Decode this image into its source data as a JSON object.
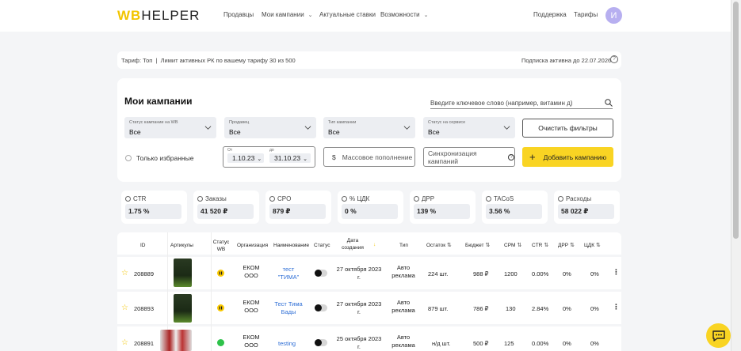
{
  "header": {
    "logo_wb": "WB",
    "logo_helper": "HELPER",
    "nav": [
      {
        "label": "Продавцы",
        "chevron": false
      },
      {
        "label": "Мои кампании",
        "chevron": true
      },
      {
        "label": "Актуальные ставки",
        "chevron": false
      },
      {
        "label": "Возможности",
        "chevron": true
      }
    ],
    "support": "Поддержка",
    "tariffs": "Тарифы",
    "avatar_letter": "И"
  },
  "tariff_bar": {
    "left": "Тариф: Топ  |  Лимит активных РК по вашему тарифу 30 из 500",
    "right": "Подписка активна до 22.07.2026"
  },
  "filters": {
    "title": "Мои кампании",
    "search_placeholder": "Введите ключевое слово (например, витамин д)",
    "selects": [
      {
        "label": "Статус кампании на WB",
        "value": "Все"
      },
      {
        "label": "Продавец",
        "value": "Все"
      },
      {
        "label": "Тип кампании",
        "value": "Все"
      },
      {
        "label": "Статус на сервисе",
        "value": "Все"
      }
    ],
    "clear_button": "Очистить фильтры",
    "favorites_only": "Только избранные",
    "date_from_label": "От",
    "date_to_label": "до",
    "date_from": "1.10.23",
    "date_to": "31.10.23",
    "mass_topup": "Массовое пополнение",
    "sync_campaigns": "Синхронизация кампаний",
    "add_campaign": "Добавить кампанию"
  },
  "metrics": [
    {
      "name": "CTR",
      "value": "1.75 %"
    },
    {
      "name": "Заказы",
      "value": "41 520 ₽"
    },
    {
      "name": "CPO",
      "value": "879 ₽"
    },
    {
      "name": "% ЦДК",
      "value": "0 %"
    },
    {
      "name": "ДРР",
      "value": "139 %"
    },
    {
      "name": "TACoS",
      "value": "3.56 %"
    },
    {
      "name": "Расходы",
      "value": "58 022 ₽"
    }
  ],
  "table": {
    "headers": {
      "id": "ID",
      "articles": "Артикулы",
      "status_wb": "Статус WB",
      "org": "Организация",
      "name": "Наименование",
      "status": "Статус",
      "created": "Дата создания",
      "type": "Тип",
      "stock": "Остаток",
      "budget": "Бюджет",
      "cpm": "CPM",
      "ctr": "CTR",
      "drr": "ДРР",
      "cdk": "ЦДК"
    },
    "rows": [
      {
        "id": "208889",
        "status_wb": "pause",
        "org": "ЕКОМ ООО",
        "name": "тест \"ТИМА\"",
        "created": "27 октября 2023 г.",
        "type": "Авто реклама",
        "stock": "224 шт.",
        "budget": "988 ₽",
        "cpm": "1200",
        "ctr": "0.00%",
        "drr": "0%",
        "cdk": "0%"
      },
      {
        "id": "208893",
        "status_wb": "pause",
        "org": "ЕКОМ ООО",
        "name": "Тест Тима Бады",
        "created": "27 октября 2023 г.",
        "type": "Авто реклама",
        "stock": "879 шт.",
        "budget": "786 ₽",
        "cpm": "130",
        "ctr": "2.84%",
        "drr": "0%",
        "cdk": "0%"
      },
      {
        "id": "208891",
        "status_wb": "active",
        "org": "ЕКОМ ООО",
        "name": "testing",
        "created": "25 октября 2023 г.",
        "type": "Авто реклама",
        "stock": "н/д шт.",
        "budget": "500 ₽",
        "cpm": "125",
        "ctr": "0.00%",
        "drr": "0%",
        "cdk": "0%"
      }
    ]
  },
  "colors": {
    "accent": "#f9d423",
    "link": "#2f6fd6",
    "active": "#2ec24a",
    "pause": "#f9c800"
  }
}
